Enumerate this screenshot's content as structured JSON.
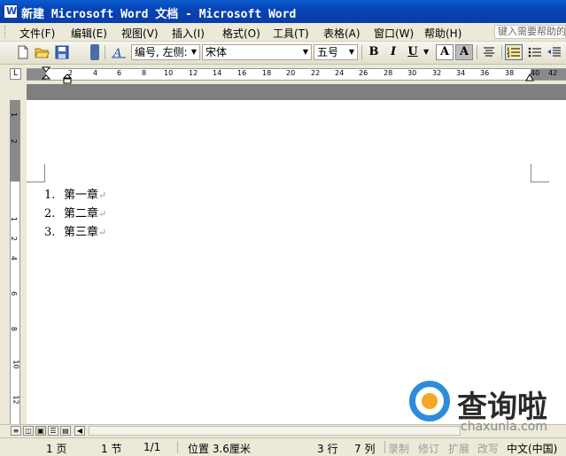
{
  "window": {
    "title": "新建 Microsoft Word 文档 - Microsoft Word"
  },
  "menu": {
    "items": [
      "文件(F)",
      "编辑(E)",
      "视图(V)",
      "插入(I)",
      "格式(O)",
      "工具(T)",
      "表格(A)",
      "窗口(W)",
      "帮助(H)"
    ],
    "help_placeholder": "键入需要帮助的"
  },
  "toolbar": {
    "style_value": "编号, 左侧:",
    "font_value": "宋体",
    "size_value": "五号",
    "bold": "B",
    "italic": "I",
    "underline": "U",
    "font_color": "A",
    "char_shading": "A"
  },
  "ruler": {
    "h_numbers": [
      "2",
      "4",
      "6",
      "8",
      "10",
      "12",
      "14",
      "16",
      "18",
      "20",
      "22",
      "24",
      "26",
      "28",
      "30",
      "32",
      "34",
      "36",
      "38",
      "40",
      "42"
    ],
    "v_numbers": [
      "1",
      "2",
      "1",
      "2",
      "4",
      "6",
      "8",
      "10",
      "12"
    ]
  },
  "document": {
    "list": [
      {
        "num": "1.",
        "text": "第一章"
      },
      {
        "num": "2.",
        "text": "第二章"
      },
      {
        "num": "3.",
        "text": "第三章"
      }
    ],
    "para_mark": "↵"
  },
  "status": {
    "page": "1 页",
    "section": "1 节",
    "pages": "1/1",
    "position": "位置 3.6厘米",
    "line": "3 行",
    "column": "7 列",
    "rec": "录制",
    "trk": "修订",
    "ext": "扩展",
    "ovr": "改写",
    "lang": "中文(中国)"
  },
  "watermark": {
    "cn": "查询啦",
    "en": "chaxunla.com"
  },
  "colors": {
    "titlebar": "#0a5ccf",
    "watermark_blue": "#2d8cdb",
    "watermark_orange": "#f6a623"
  }
}
